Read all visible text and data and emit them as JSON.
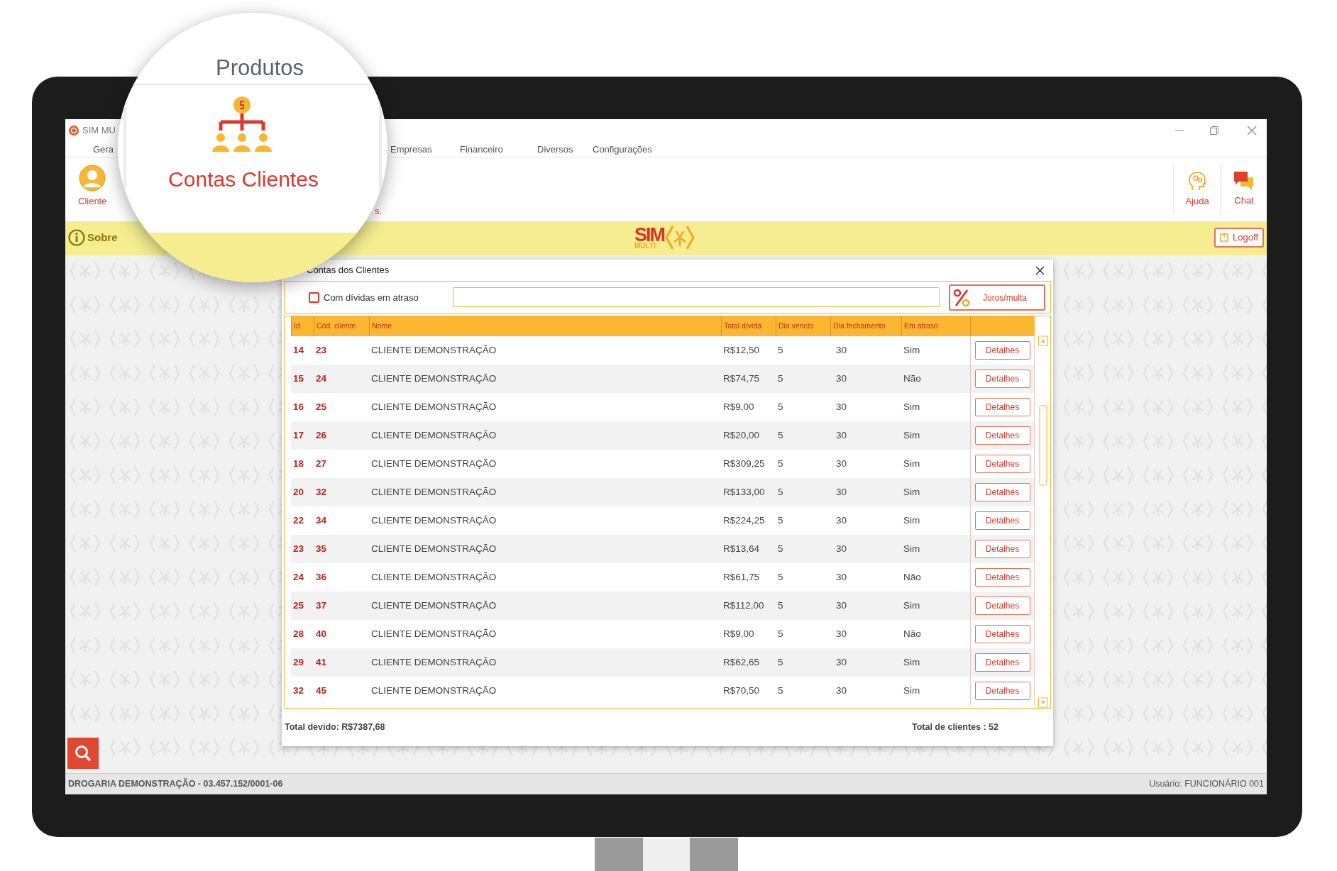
{
  "window": {
    "title": "SIM MU"
  },
  "menu": [
    "Gera",
    "Empresas",
    "Financeiro",
    "Diversos",
    "Configurações"
  ],
  "ribbon": {
    "left": [
      {
        "kind": "client",
        "label": "Cliente"
      },
      {
        "kind": "fragment",
        "label": "s."
      }
    ],
    "right": [
      {
        "kind": "help",
        "label": "Ajuda"
      },
      {
        "kind": "chat",
        "label": "Chat"
      }
    ]
  },
  "banner": {
    "about": "Sobre",
    "logo": {
      "text": "SIM",
      "subtext": "MULTI"
    },
    "logoff": "Logoff"
  },
  "magnifier": {
    "tab": "Produtos",
    "item": "Contas Clientes"
  },
  "dialog": {
    "title": "Contas dos Clientes",
    "filter": {
      "label": "Com dívidas em atraso",
      "checked": false
    },
    "rate_button": "Juros/multa",
    "columns": [
      "Id",
      "Cód. cliente",
      "Nome",
      "Total dívida",
      "Dia vencto",
      "Dia fechamento",
      "Em atraso"
    ],
    "rows": [
      {
        "id": "14",
        "code": "23",
        "name": "CLIENTE DEMONSTRAÇÃO",
        "total": "R$12,50",
        "due_day": "5",
        "closing_day": "30",
        "overdue": "Sim",
        "action": "Detalhes"
      },
      {
        "id": "15",
        "code": "24",
        "name": "CLIENTE DEMONSTRAÇÃO",
        "total": "R$74,75",
        "due_day": "5",
        "closing_day": "30",
        "overdue": "Não",
        "action": "Detalhes"
      },
      {
        "id": "16",
        "code": "25",
        "name": "CLIENTE DEMONSTRAÇÃO",
        "total": "R$9,00",
        "due_day": "5",
        "closing_day": "30",
        "overdue": "Sim",
        "action": "Detalhes"
      },
      {
        "id": "17",
        "code": "26",
        "name": "CLIENTE DEMONSTRAÇÃO",
        "total": "R$20,00",
        "due_day": "5",
        "closing_day": "30",
        "overdue": "Sim",
        "action": "Detalhes"
      },
      {
        "id": "18",
        "code": "27",
        "name": "CLIENTE DEMONSTRAÇÃO",
        "total": "R$309,25",
        "due_day": "5",
        "closing_day": "30",
        "overdue": "Sim",
        "action": "Detalhes"
      },
      {
        "id": "20",
        "code": "32",
        "name": "CLIENTE DEMONSTRAÇÃO",
        "total": "R$133,00",
        "due_day": "5",
        "closing_day": "30",
        "overdue": "Sim",
        "action": "Detalhes"
      },
      {
        "id": "22",
        "code": "34",
        "name": "CLIENTE DEMONSTRAÇÃO",
        "total": "R$224,25",
        "due_day": "5",
        "closing_day": "30",
        "overdue": "Sim",
        "action": "Detalhes"
      },
      {
        "id": "23",
        "code": "35",
        "name": "CLIENTE DEMONSTRAÇÃO",
        "total": "R$13,64",
        "due_day": "5",
        "closing_day": "30",
        "overdue": "Sim",
        "action": "Detalhes"
      },
      {
        "id": "24",
        "code": "36",
        "name": "CLIENTE DEMONSTRAÇÃO",
        "total": "R$61,75",
        "due_day": "5",
        "closing_day": "30",
        "overdue": "Não",
        "action": "Detalhes"
      },
      {
        "id": "25",
        "code": "37",
        "name": "CLIENTE DEMONSTRAÇÃO",
        "total": "R$112,00",
        "due_day": "5",
        "closing_day": "30",
        "overdue": "Sim",
        "action": "Detalhes"
      },
      {
        "id": "28",
        "code": "40",
        "name": "CLIENTE DEMONSTRAÇÃO",
        "total": "R$9,00",
        "due_day": "5",
        "closing_day": "30",
        "overdue": "Não",
        "action": "Detalhes"
      },
      {
        "id": "29",
        "code": "41",
        "name": "CLIENTE DEMONSTRAÇÃO",
        "total": "R$62,65",
        "due_day": "5",
        "closing_day": "30",
        "overdue": "Sim",
        "action": "Detalhes"
      },
      {
        "id": "32",
        "code": "45",
        "name": "CLIENTE DEMONSTRAÇÃO",
        "total": "R$70,50",
        "due_day": "5",
        "closing_day": "30",
        "overdue": "Sim",
        "action": "Detalhes"
      }
    ],
    "total_due": "Total devido: R$7387,68",
    "total_clients": "Total de clientes : 52"
  },
  "status_bar": {
    "company": "DROGARIA DEMONSTRAÇÃO - 03.457.152/0001-06",
    "user": "Usuário: FUNCIONÁRIO 001"
  }
}
